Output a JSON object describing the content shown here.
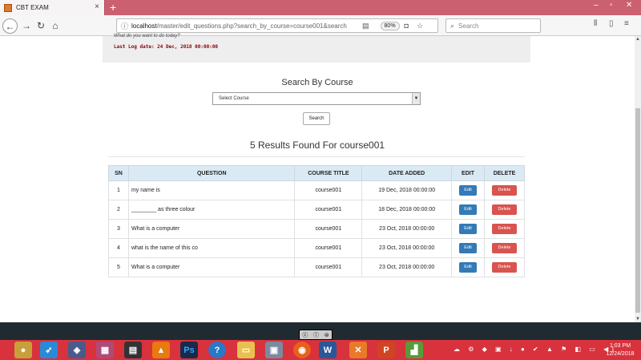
{
  "browser": {
    "tab_title": "CBT EXAM",
    "url_host": "localhost",
    "url_path": "/master/edit_questions.php?search_by_course=course001&search",
    "zoom": "80%",
    "search_placeholder": "Search"
  },
  "info": {
    "subtitle": "What do you want to do today?",
    "last_log": "Last Log date: 24 Dec, 2018 00:00:00"
  },
  "search": {
    "title": "Search By Course",
    "select_value": "Select Course",
    "button": "Search"
  },
  "results": {
    "title": "5 Results Found For course001",
    "columns": [
      "SN",
      "QUESTION",
      "COURSE TITLE",
      "DATE ADDED",
      "EDIT",
      "DELETE"
    ],
    "edit_label": "Edit",
    "delete_label": "Delete",
    "rows": [
      {
        "sn": "1",
        "question": "my name is",
        "course": "course001",
        "date": "19 Dec, 2018 00:00:00"
      },
      {
        "sn": "2",
        "question": "________ as three colour",
        "course": "course001",
        "date": "18 Dec, 2018 00:00:00"
      },
      {
        "sn": "3",
        "question": " What is a computer",
        "course": "course001",
        "date": "23 Oct, 2018 00:00:00"
      },
      {
        "sn": "4",
        "question": "what is the name of this co",
        "course": "course001",
        "date": "23 Oct, 2018 00:00:00"
      },
      {
        "sn": "5",
        "question": " What is a computer",
        "course": "course001",
        "date": "23 Oct, 2018 00:00:00"
      }
    ]
  },
  "taskbar": {
    "apps": [
      {
        "name": "app-1",
        "glyph": "●",
        "color": "#c8a03a"
      },
      {
        "name": "rocket",
        "glyph": "➶",
        "color": "#2a8ad8"
      },
      {
        "name": "shield",
        "glyph": "◈",
        "color": "#4a5a8a"
      },
      {
        "name": "puzzle",
        "glyph": "▦",
        "color": "#b04a7a"
      },
      {
        "name": "film",
        "glyph": "▤",
        "color": "#333333"
      },
      {
        "name": "vlc",
        "glyph": "▲",
        "color": "#e87a10"
      },
      {
        "name": "photoshop",
        "glyph": "Ps",
        "color": "#1a2a4a"
      },
      {
        "name": "help",
        "glyph": "?",
        "color": "#2a78c8"
      },
      {
        "name": "file-explorer",
        "glyph": "▭",
        "color": "#e8c050"
      },
      {
        "name": "computer",
        "glyph": "▣",
        "color": "#7a8aa0"
      },
      {
        "name": "firefox",
        "glyph": "◉",
        "color": "#e8601a"
      },
      {
        "name": "word",
        "glyph": "W",
        "color": "#2b579a"
      },
      {
        "name": "xampp",
        "glyph": "✕",
        "color": "#e87a2a"
      },
      {
        "name": "powerpoint",
        "glyph": "P",
        "color": "#d04423"
      },
      {
        "name": "chart",
        "glyph": "▟",
        "color": "#5a9a3a"
      }
    ],
    "clock_time": "1:03 PM",
    "clock_date": "12/24/2018"
  }
}
